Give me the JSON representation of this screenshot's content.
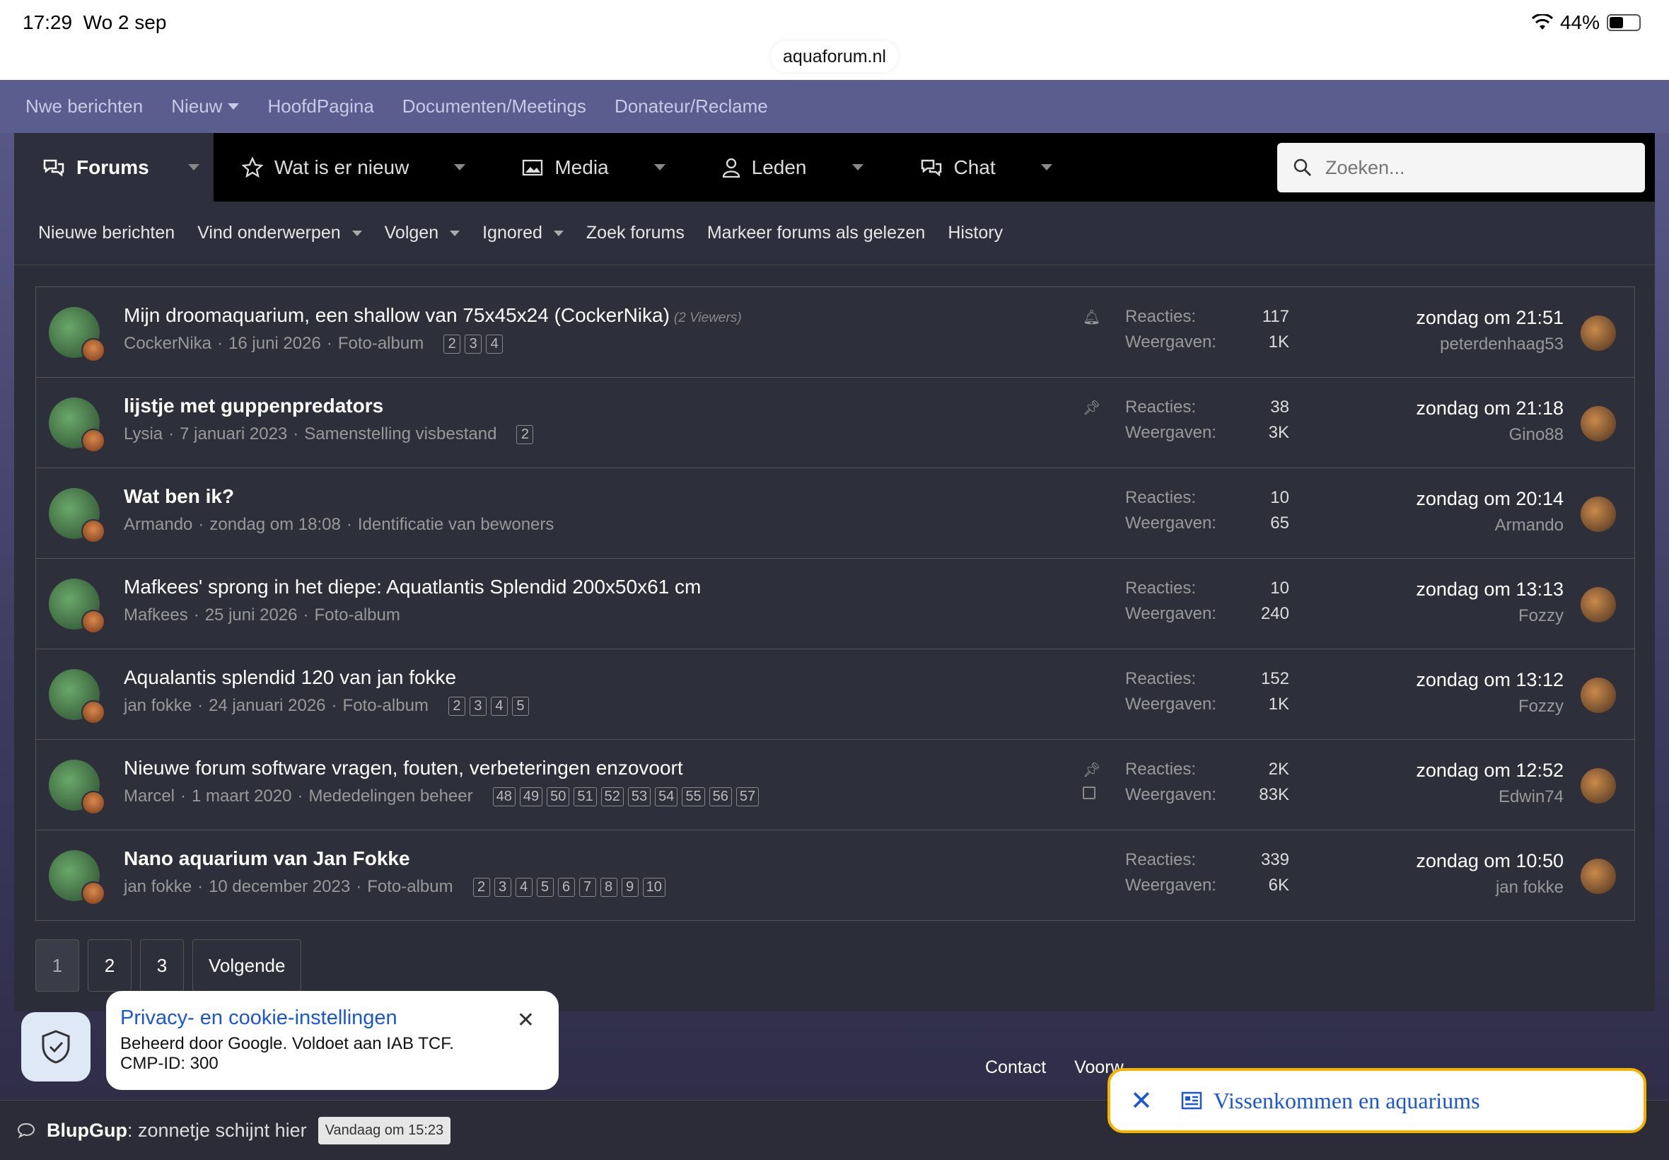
{
  "status": {
    "time": "17:29",
    "date": "Wo 2 sep",
    "battery": "44%"
  },
  "browser": {
    "url": "aquaforum.nl"
  },
  "topnav": {
    "items": [
      "Nwe berichten",
      "Nieuw",
      "HoofdPagina",
      "Documenten/Meetings",
      "Donateur/Reclame"
    ]
  },
  "mainnav": {
    "tabs": [
      "Forums",
      "Wat is er nieuw",
      "Media",
      "Leden",
      "Chat"
    ],
    "search_placeholder": "Zoeken..."
  },
  "subnav": {
    "items": [
      "Nieuwe berichten",
      "Vind onderwerpen",
      "Volgen",
      "Ignored",
      "Zoek forums",
      "Markeer forums als gelezen",
      "History"
    ]
  },
  "labels": {
    "reacties": "Reacties:",
    "weergaven": "Weergaven:"
  },
  "threads": [
    {
      "title": "Mijn droomaquarium, een shallow van 75x45x24 (CockerNika)",
      "viewers": "(2 Viewers)",
      "author": "CockerNika",
      "date": "16 juni 2026",
      "forum": "Foto-album",
      "pages": [
        "2",
        "3",
        "4"
      ],
      "reacties": "117",
      "weergaven": "1K",
      "last_date": "zondag om 21:51",
      "last_user": "peterdenhaag53"
    },
    {
      "title": "lijstje met guppenpredators",
      "author": "Lysia",
      "date": "7 januari 2023",
      "forum": "Samenstelling visbestand",
      "pages": [
        "2"
      ],
      "reacties": "38",
      "weergaven": "3K",
      "last_date": "zondag om 21:18",
      "last_user": "Gino88"
    },
    {
      "title": "Wat ben ik?",
      "author": "Armando",
      "date": "zondag om 18:08",
      "forum": "Identificatie van bewoners",
      "pages": [],
      "reacties": "10",
      "weergaven": "65",
      "last_date": "zondag om 20:14",
      "last_user": "Armando"
    },
    {
      "title": "Mafkees' sprong in het diepe: Aquatlantis Splendid 200x50x61 cm",
      "author": "Mafkees",
      "date": "25 juni 2026",
      "forum": "Foto-album",
      "pages": [],
      "reacties": "10",
      "weergaven": "240",
      "last_date": "zondag om 13:13",
      "last_user": "Fozzy"
    },
    {
      "title": "Aqualantis splendid 120 van jan fokke",
      "author": "jan fokke",
      "date": "24 januari 2026",
      "forum": "Foto-album",
      "pages": [
        "2",
        "3",
        "4",
        "5"
      ],
      "reacties": "152",
      "weergaven": "1K",
      "last_date": "zondag om 13:12",
      "last_user": "Fozzy"
    },
    {
      "title": "Nieuwe forum software vragen, fouten, verbeteringen enzovoort",
      "author": "Marcel",
      "date": "1 maart 2020",
      "forum": "Mededelingen beheer",
      "pages": [
        "48",
        "49",
        "50",
        "51",
        "52",
        "53",
        "54",
        "55",
        "56",
        "57"
      ],
      "reacties": "2K",
      "weergaven": "83K",
      "last_date": "zondag om 12:52",
      "last_user": "Edwin74"
    },
    {
      "title": "Nano aquarium van Jan Fokke",
      "author": "jan fokke",
      "date": "10 december 2023",
      "forum": "Foto-album",
      "pages": [
        "2",
        "3",
        "4",
        "5",
        "6",
        "7",
        "8",
        "9",
        "10"
      ],
      "reacties": "339",
      "weergaven": "6K",
      "last_date": "zondag om 10:50",
      "last_user": "jan fokke"
    }
  ],
  "pagination": {
    "pages": [
      "1",
      "2",
      "3"
    ],
    "next": "Volgende"
  },
  "footer": {
    "contact": "Contact",
    "partial": "Voorw"
  },
  "cookie": {
    "title": "Privacy- en cookie-instellingen",
    "body": "Beheerd door Google. Voldoet aan IAB TCF. CMP-ID: 300"
  },
  "chat": {
    "user": "BlupGup",
    "message": ": zonnetje schijnt hier",
    "time": "Vandaag om 15:23"
  },
  "google_pill": {
    "label": "Vissenkommen en aquariums"
  }
}
